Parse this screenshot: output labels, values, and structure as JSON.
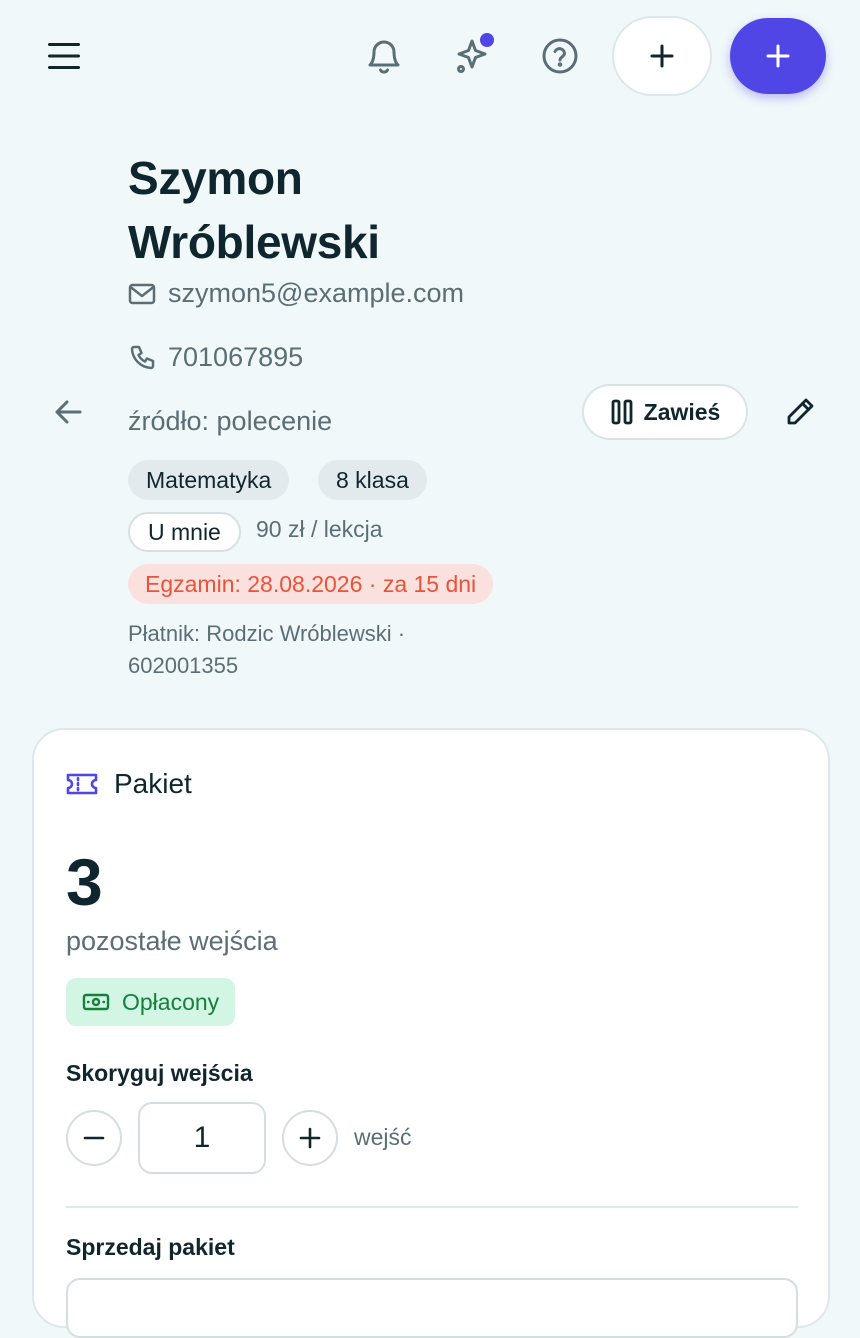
{
  "header": {
    "menu_icon": "hamburger-icon",
    "bell_icon": "bell-icon",
    "sparkle_icon": "sparkle-icon",
    "help_icon": "help-icon",
    "add_icon": "plus-icon",
    "accent_color": "#4f46e5"
  },
  "student": {
    "first_name": "Szymon",
    "last_name": "Wróblewski",
    "email": "szymon5@example.com",
    "phone": "701067895",
    "source": "źródło: polecenie",
    "subject": "Matematyka",
    "grade": "8 klasa",
    "location": "U mnie",
    "price": "90 zł / lekcja",
    "exam": "Egzamin: 28.08.2026 · za 15 dni",
    "payer": "Płatnik: Rodzic Wróblewski · 602001355"
  },
  "actions": {
    "suspend_label": "Zawieś"
  },
  "package": {
    "title": "Pakiet",
    "remaining": "3",
    "remaining_label": "pozostałe wejścia",
    "status": "Opłacony",
    "adjust_label": "Skoryguj wejścia",
    "adjust_value": "1",
    "adjust_unit": "wejść",
    "sell_label": "Sprzedaj pakiet"
  }
}
